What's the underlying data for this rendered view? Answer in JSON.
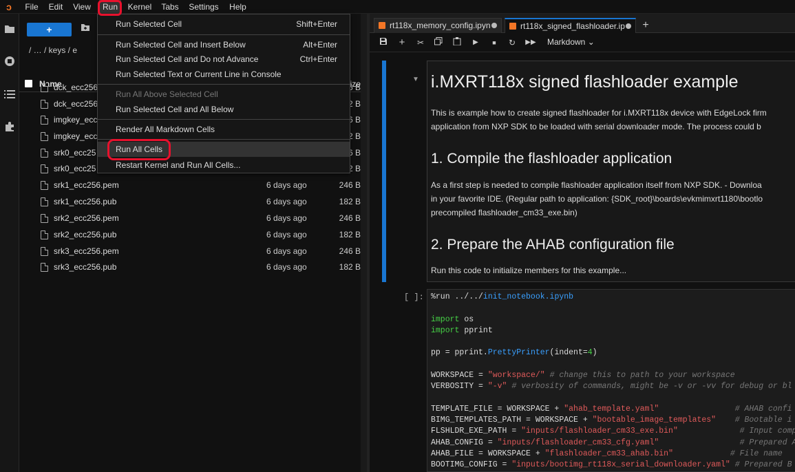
{
  "menubar": {
    "items": [
      "File",
      "Edit",
      "View",
      "Run",
      "Kernel",
      "Tabs",
      "Settings",
      "Help"
    ]
  },
  "filebrowser": {
    "new_label": "+",
    "breadcrumbs": "/   …   / keys / e",
    "col_name": "Name",
    "col_size": "ize",
    "files": [
      {
        "name": "dck_ecc256.",
        "modified": "",
        "size": "6 B"
      },
      {
        "name": "dck_ecc256.",
        "modified": "",
        "size": "2 B"
      },
      {
        "name": "imgkey_ecc",
        "modified": "",
        "size": "6 B"
      },
      {
        "name": "imgkey_ecc",
        "modified": "",
        "size": "2 B"
      },
      {
        "name": "srk0_ecc25",
        "modified": "",
        "size": "6 B"
      },
      {
        "name": "srk0_ecc25",
        "modified": "",
        "size": "2 B"
      },
      {
        "name": "srk1_ecc256.pem",
        "modified": "6 days ago",
        "size": "246 B"
      },
      {
        "name": "srk1_ecc256.pub",
        "modified": "6 days ago",
        "size": "182 B"
      },
      {
        "name": "srk2_ecc256.pem",
        "modified": "6 days ago",
        "size": "246 B"
      },
      {
        "name": "srk2_ecc256.pub",
        "modified": "6 days ago",
        "size": "182 B"
      },
      {
        "name": "srk3_ecc256.pem",
        "modified": "6 days ago",
        "size": "246 B"
      },
      {
        "name": "srk3_ecc256.pub",
        "modified": "6 days ago",
        "size": "182 B"
      }
    ]
  },
  "tabs": [
    {
      "label": "rt118x_memory_config.ipyn"
    },
    {
      "label": "rt118x_signed_flashloader.ip"
    }
  ],
  "toolbar": {
    "cell_type": "Markdown"
  },
  "markdown": {
    "title": "i.MXRT118x signed flashloader example",
    "p1_line1": "This is example how to create signed flashloader for i.MXRT118x device with EdgeLock firm",
    "p1_line2": "application from NXP SDK to be loaded with serial downloader mode. The process could b",
    "h2_1": "1. Compile the flashloader application",
    "p2_line1": "As a first step is needed to compile flashloader application itself from NXP SDK. - Downloa",
    "p2_line2": "in your favorite IDE. (Regular path to application: {SDK_root}\\boards\\evkmimxrt1180\\bootlo",
    "p2_line3": "precompiled flashloader_cm33_exe.bin)",
    "h2_2": "2. Prepare the AHAB configuration file",
    "p3": "Run this code to initialize members for this example..."
  },
  "code": {
    "prompt": "[ ]:"
  },
  "run_menu": {
    "items": [
      {
        "label": "Run Selected Cell",
        "shortcut": "Shift+Enter"
      },
      {
        "label": "Run Selected Cell and Insert Below",
        "shortcut": "Alt+Enter"
      },
      {
        "label": "Run Selected Cell and Do not Advance",
        "shortcut": "Ctrl+Enter"
      },
      {
        "label": "Run Selected Text or Current Line in Console",
        "shortcut": ""
      },
      {
        "label": "Run All Above Selected Cell",
        "shortcut": ""
      },
      {
        "label": "Run Selected Cell and All Below",
        "shortcut": ""
      },
      {
        "label": "Render All Markdown Cells",
        "shortcut": ""
      },
      {
        "label": "Run All Cells",
        "shortcut": ""
      },
      {
        "label": "Restart Kernel and Run All Cells...",
        "shortcut": ""
      }
    ]
  },
  "colors": {
    "accent": "#1976d2",
    "annotation_red": "#e8112d",
    "jupyter_orange": "#f37626"
  }
}
